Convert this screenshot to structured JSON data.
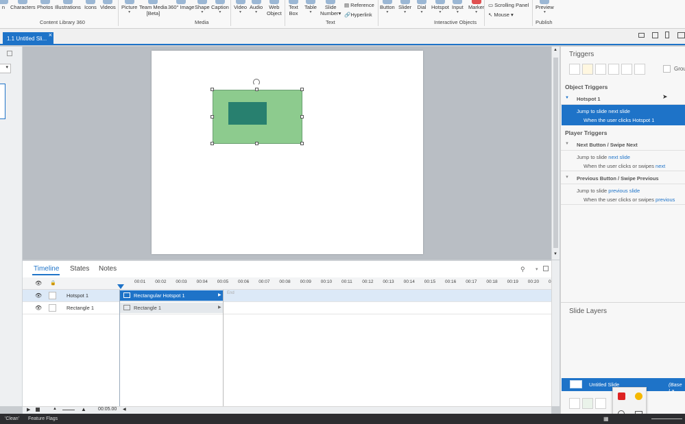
{
  "ribbon": {
    "buttons": [
      {
        "label": "n",
        "sub": ""
      },
      {
        "label": "Characters",
        "sub": ""
      },
      {
        "label": "Photos",
        "sub": ""
      },
      {
        "label": "Illustrations",
        "sub": ""
      },
      {
        "label": "Icons",
        "sub": ""
      },
      {
        "label": "Videos",
        "sub": ""
      },
      {
        "label": "Picture",
        "sub": "▾"
      },
      {
        "label": "Team Media",
        "sub": "[Beta]"
      },
      {
        "label": "360° Image",
        "sub": ""
      },
      {
        "label": "Shape",
        "sub": "▾"
      },
      {
        "label": "Caption",
        "sub": "▾"
      },
      {
        "label": "Video",
        "sub": "▾"
      },
      {
        "label": "Audio",
        "sub": "▾"
      },
      {
        "label": "Web",
        "sub": "Object"
      },
      {
        "label": "Text",
        "sub": "Box"
      },
      {
        "label": "Table",
        "sub": "▾"
      },
      {
        "label": "Slide",
        "sub": "Number▾"
      },
      {
        "label": "Button",
        "sub": "▾"
      },
      {
        "label": "Slider",
        "sub": "▾"
      },
      {
        "label": "Dial",
        "sub": "▾"
      },
      {
        "label": "Hotspot",
        "sub": "▾"
      },
      {
        "label": "Input",
        "sub": "▾"
      },
      {
        "label": "Marker",
        "sub": "▾"
      },
      {
        "label": "Preview",
        "sub": "▾"
      }
    ],
    "small": {
      "reference": "Reference",
      "hyperlink": "Hyperlink",
      "scrolling": "Scrolling Panel",
      "mouse": "Mouse ▾"
    },
    "groups": {
      "content_library": "Content Library 360",
      "media": "Media",
      "text": "Text",
      "interactive": "Interactive Objects",
      "publish": "Publish"
    }
  },
  "tab": {
    "title": "1.1 Untitled Sli...",
    "close": "×"
  },
  "timeline": {
    "tabs": [
      "Timeline",
      "States",
      "Notes"
    ],
    "ticks": [
      "00:01",
      "00:02",
      "00:03",
      "00:04",
      "00:05",
      "00:06",
      "00:07",
      "00:08",
      "00:09",
      "00:10",
      "00:11",
      "00:12",
      "00:13",
      "00:14",
      "00:15",
      "00:16",
      "00:17",
      "00:18",
      "00:19",
      "00:20",
      "0"
    ],
    "rows": [
      {
        "name": "Hotspot 1",
        "bar": "Rectangular Hotspot 1"
      },
      {
        "name": "Rectangle 1",
        "bar": "Rectangle 1"
      }
    ],
    "end_label": "End",
    "duration": "00:05.00"
  },
  "triggers": {
    "title": "Triggers",
    "group_label": "Grou",
    "object_section": "Object Triggers",
    "hotspot_header": "Hotspot 1",
    "hotspot_action": "Jump to slide",
    "hotspot_target": "next slide",
    "hotspot_cond": "When the user clicks Hotspot 1",
    "player_section": "Player Triggers",
    "next_header": "Next Button / Swipe Next",
    "next_action": "Jump to slide",
    "next_target": "next slide",
    "next_cond": "When the user clicks or swipes",
    "next_cond_link": "next",
    "prev_header": "Previous Button / Swipe Previous",
    "prev_action": "Jump to slide",
    "prev_target": "previous slide",
    "prev_cond": "When the user clicks or swipes",
    "prev_cond_link": "previous"
  },
  "layers": {
    "title": "Slide Layers",
    "base_name": "Untitled Slide",
    "base_tag": "(Base La"
  },
  "status": {
    "skin": "'Clean'",
    "flags": "Feature Flags"
  },
  "colors": {
    "accent": "#1e73c8",
    "rect_fill": "#8dcb8e",
    "hotspot": "#1f7a6c"
  }
}
